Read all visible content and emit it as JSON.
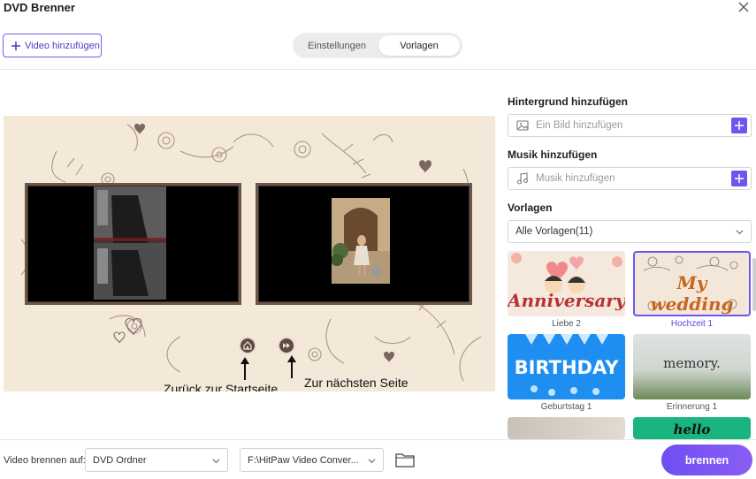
{
  "window": {
    "title": "DVD Brenner"
  },
  "toolbar": {
    "add_video_label": "Video hinzufügen"
  },
  "tabs": [
    {
      "label": "Einstellungen",
      "active": false
    },
    {
      "label": "Vorlagen",
      "active": true
    }
  ],
  "preview": {
    "caption_home": "Zurück zur Startseite",
    "caption_next": "Zur nächsten Seite"
  },
  "panel": {
    "background": {
      "title": "Hintergrund hinzufügen",
      "placeholder": "Ein Bild hinzufügen"
    },
    "music": {
      "title": "Musik hinzufügen",
      "placeholder": "Musik hinzufügen"
    },
    "templates": {
      "title": "Vorlagen",
      "filter_value": "Alle Vorlagen(11)",
      "items": [
        {
          "label": "Liebe 2",
          "art_text": "Anniversary",
          "selected": false
        },
        {
          "label": "Hochzeit 1",
          "art_text": "My wedding",
          "selected": true
        },
        {
          "label": "Geburtstag 1",
          "art_text": "BIRTHDAY",
          "selected": false
        },
        {
          "label": "Erinnerung 1",
          "art_text": "memory.",
          "selected": false
        },
        {
          "label": "",
          "art_text": "",
          "selected": false
        },
        {
          "label": "",
          "art_text": "hello",
          "selected": false
        }
      ]
    }
  },
  "bottom": {
    "burn_to_label": "Video brennen auf:",
    "output_type": "DVD Ordner",
    "output_path": "F:\\HitPaw Video Conver...",
    "burn_button": "brennen"
  },
  "colors": {
    "accent": "#6d55f0",
    "preview_bg": "#f4e8d9",
    "frame": "#6b5649"
  }
}
